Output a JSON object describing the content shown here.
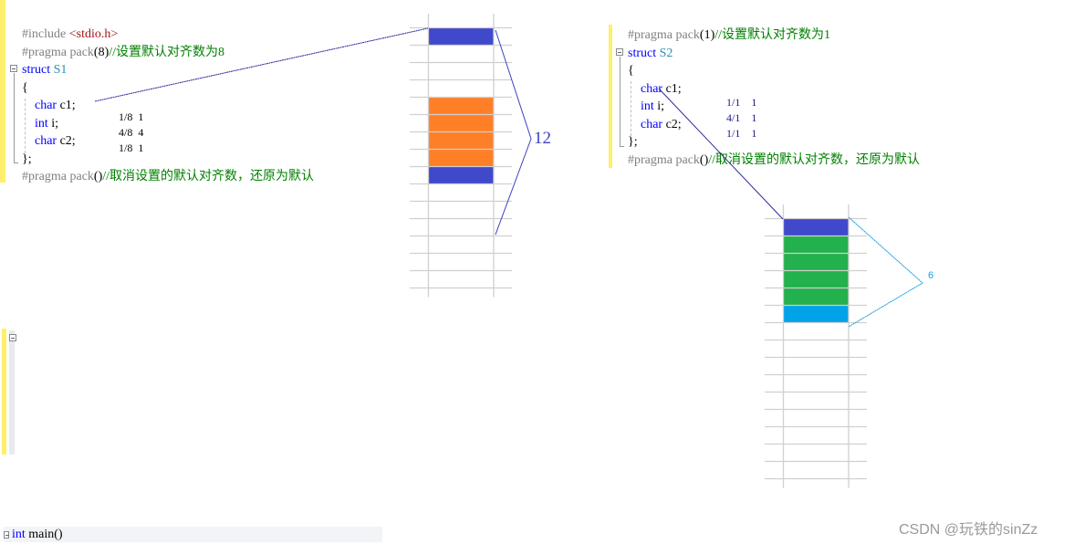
{
  "left_panel": {
    "code_lines": [
      {
        "parts": [
          {
            "t": "#include ",
            "c": "pre"
          },
          {
            "t": "<stdio.h>",
            "c": "str"
          }
        ]
      },
      {
        "parts": [
          {
            "t": "#pragma pack",
            "c": "pre"
          },
          {
            "t": "(8)",
            "c": "plain"
          },
          {
            "t": "//设置默认对齐数为8",
            "c": "cmt"
          }
        ]
      },
      {
        "parts": [
          {
            "t": "struct ",
            "c": "kw"
          },
          {
            "t": "S1",
            "c": "type"
          }
        ]
      },
      {
        "parts": [
          {
            "t": "{",
            "c": "plain"
          }
        ]
      },
      {
        "parts": [
          {
            "t": "    char ",
            "c": "kw"
          },
          {
            "t": "c1;",
            "c": "plain"
          }
        ]
      },
      {
        "parts": [
          {
            "t": "    int ",
            "c": "kw"
          },
          {
            "t": "i;",
            "c": "plain"
          }
        ]
      },
      {
        "parts": [
          {
            "t": "    char ",
            "c": "kw"
          },
          {
            "t": "c2;",
            "c": "plain"
          }
        ]
      },
      {
        "parts": [
          {
            "t": "};",
            "c": "plain"
          }
        ]
      },
      {
        "parts": [
          {
            "t": "#pragma pack",
            "c": "pre"
          },
          {
            "t": "()",
            "c": "plain"
          },
          {
            "t": "//取消设置的默认对齐数，还原为默认",
            "c": "cmt"
          }
        ]
      }
    ],
    "annotations": [
      {
        "ratio": "1/8",
        "align": "1"
      },
      {
        "ratio": "4/8",
        "align": "4"
      },
      {
        "ratio": "1/8",
        "align": "1"
      }
    ],
    "total_size_label": "12",
    "main_line": {
      "parts": [
        {
          "t": "int ",
          "c": "kw"
        },
        {
          "t": "main()",
          "c": "plain"
        }
      ]
    }
  },
  "right_panel": {
    "code_lines": [
      {
        "parts": [
          {
            "t": "#pragma pack",
            "c": "pre"
          },
          {
            "t": "(1)",
            "c": "plain"
          },
          {
            "t": "//设置默认对齐数为1",
            "c": "cmt"
          }
        ]
      },
      {
        "parts": [
          {
            "t": "struct ",
            "c": "kw"
          },
          {
            "t": "S2",
            "c": "type"
          }
        ]
      },
      {
        "parts": [
          {
            "t": "{",
            "c": "plain"
          }
        ]
      },
      {
        "parts": [
          {
            "t": "    char ",
            "c": "kw"
          },
          {
            "t": "c1;",
            "c": "plain"
          }
        ]
      },
      {
        "parts": [
          {
            "t": "    int ",
            "c": "kw"
          },
          {
            "t": "i;",
            "c": "plain"
          }
        ]
      },
      {
        "parts": [
          {
            "t": "    char ",
            "c": "kw"
          },
          {
            "t": "c2;",
            "c": "plain"
          }
        ]
      },
      {
        "parts": [
          {
            "t": "};",
            "c": "plain"
          }
        ]
      },
      {
        "parts": [
          {
            "t": "#pragma pack",
            "c": "pre"
          },
          {
            "t": "()",
            "c": "plain"
          },
          {
            "t": "//取消设置的默认对齐数，还原为默认",
            "c": "cmt"
          }
        ]
      }
    ],
    "annotations": [
      {
        "ratio": "1/1",
        "align": "1"
      },
      {
        "ratio": "4/1",
        "align": "1"
      },
      {
        "ratio": "1/1",
        "align": "1"
      }
    ],
    "total_size_label": "6"
  },
  "memory_left": {
    "rows": 15,
    "cells": [
      "c1",
      "pad",
      "pad",
      "pad",
      "i",
      "i",
      "i",
      "i",
      "c2",
      "",
      "",
      "",
      "",
      "",
      ""
    ]
  },
  "memory_right": {
    "rows": 15,
    "cells": [
      "c1",
      "i",
      "i",
      "i",
      "i",
      "c2",
      "",
      "",
      "",
      "",
      "",
      "",
      "",
      "",
      ""
    ]
  },
  "colors": {
    "c1": "#4048cc",
    "i_left": "#ff7f27",
    "i_right": "#22b14c",
    "c2_left": "#4048cc",
    "c2_right": "#00a2e8",
    "grid": "#d0d0d0",
    "bracket_left": "#3f3fbf",
    "bracket_right": "#1aa0e0"
  },
  "watermark": "CSDN @玩铁的sinZz"
}
